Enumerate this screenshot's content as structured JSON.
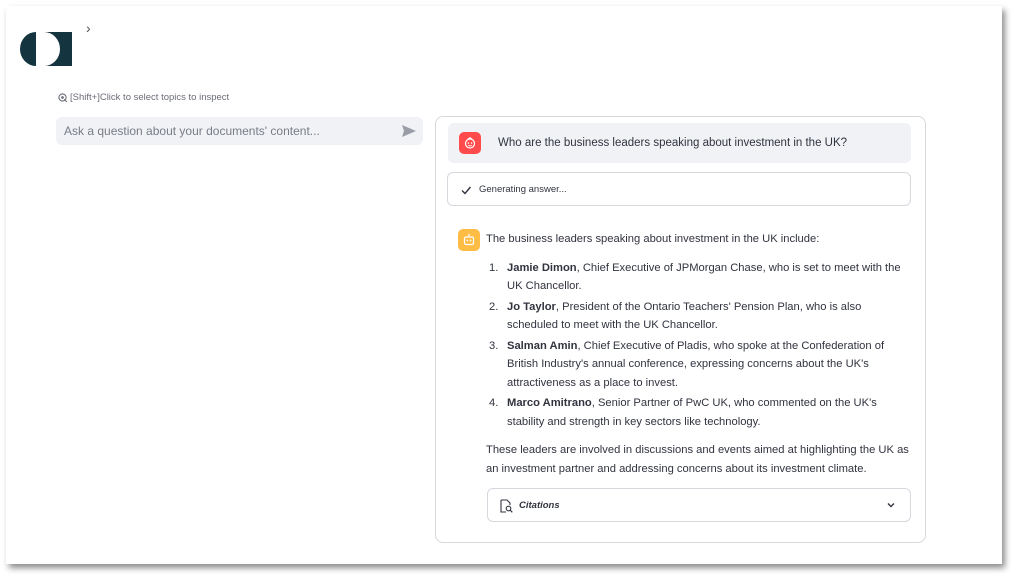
{
  "sidebar_toggle": "›",
  "hint": "[Shift+]Click to select topics to inspect",
  "search": {
    "placeholder": "Ask a question about your documents' content...",
    "value": ""
  },
  "chat": {
    "question": "Who are the business leaders speaking about investment in the UK?",
    "status": "Generating answer...",
    "answer": {
      "intro": "The business leaders speaking about investment in the UK include:",
      "items": [
        {
          "num": "1.",
          "name": "Jamie Dimon",
          "text": ", Chief Executive of JPMorgan Chase, who is set to meet with the UK Chancellor."
        },
        {
          "num": "2.",
          "name": "Jo Taylor",
          "text": ", President of the Ontario Teachers' Pension Plan, who is also scheduled to meet with the UK Chancellor."
        },
        {
          "num": "3.",
          "name": "Salman Amin",
          "text": ", Chief Executive of Pladis, who spoke at the Confederation of British Industry's annual conference, expressing concerns about the UK's attractiveness as a place to invest."
        },
        {
          "num": "4.",
          "name": "Marco Amitrano",
          "text": ", Senior Partner of PwC UK, who commented on the UK's stability and strength in key sectors like technology."
        }
      ],
      "outro": "These leaders are involved in discussions and events aimed at highlighting the UK as an investment partner and addressing concerns about its investment climate."
    },
    "citations_label": "Citations"
  },
  "colors": {
    "user_avatar": "#ff4b4b",
    "bot_avatar": "#ffbd45",
    "logo": "#14343f"
  },
  "icons": [
    "logo",
    "chevron-right-icon",
    "target-icon",
    "send-icon",
    "user-avatar-icon",
    "bot-avatar-icon",
    "check-icon",
    "document-search-icon",
    "chevron-down-icon"
  ]
}
